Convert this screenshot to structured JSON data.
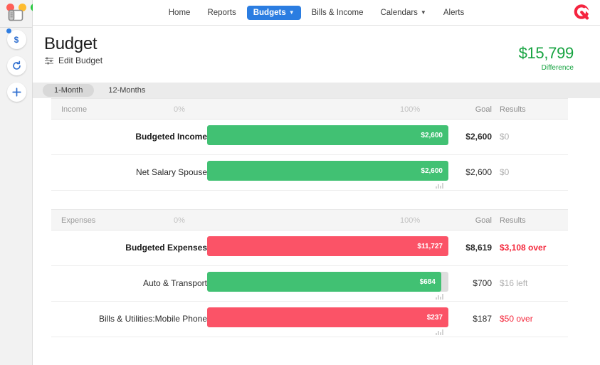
{
  "window": {
    "traffic_lights": [
      "close",
      "minimize",
      "maximize"
    ],
    "sidebar_toggle_icon": "sidebar-toggle-icon"
  },
  "rail": {
    "items": [
      {
        "icon": "dollar-circle-icon",
        "glyph": "$",
        "has_badge": true
      },
      {
        "icon": "refresh-circle-icon",
        "glyph": "↻",
        "has_badge": false
      },
      {
        "icon": "plus-circle-icon",
        "glyph": "+",
        "has_badge": false
      }
    ]
  },
  "nav": {
    "items": [
      {
        "label": "Home",
        "active": false,
        "has_caret": false
      },
      {
        "label": "Reports",
        "active": false,
        "has_caret": false
      },
      {
        "label": "Budgets",
        "active": true,
        "has_caret": true
      },
      {
        "label": "Bills & Income",
        "active": false,
        "has_caret": false
      },
      {
        "label": "Calendars",
        "active": false,
        "has_caret": true
      },
      {
        "label": "Alerts",
        "active": false,
        "has_caret": false
      }
    ],
    "logo_icon": "quicken-q-logo"
  },
  "header": {
    "title": "Budget",
    "edit_budget_label": "Edit Budget",
    "edit_budget_icon": "sliders-icon",
    "difference_amount": "$15,799",
    "difference_label": "Difference"
  },
  "tabs": [
    {
      "label": "1-Month",
      "active": true
    },
    {
      "label": "12-Months",
      "active": false
    }
  ],
  "colors": {
    "green": "#41c173",
    "red": "#fb5367",
    "accent_blue": "#2b7de1",
    "difference_green": "#16a340",
    "over_red": "#f4283c",
    "track_gray": "#dedede"
  },
  "columns": {
    "zero": "0%",
    "full": "100%",
    "goal": "Goal",
    "results": "Results"
  },
  "sections": [
    {
      "name": "Income",
      "rows": [
        {
          "label": "Budgeted Income",
          "bold": true,
          "bar_value": "$2,600",
          "bar_color": "green",
          "bar_percent": 100,
          "goal": "$2,600",
          "goal_bold": true,
          "results": "$0",
          "results_state": "muted",
          "sparkline": false
        },
        {
          "label": "Net Salary Spouse",
          "bold": false,
          "bar_value": "$2,600",
          "bar_color": "green",
          "bar_percent": 100,
          "goal": "$2,600",
          "goal_bold": false,
          "results": "$0",
          "results_state": "muted",
          "sparkline": true
        }
      ]
    },
    {
      "name": "Expenses",
      "rows": [
        {
          "label": "Budgeted Expenses",
          "bold": true,
          "bar_value": "$11,727",
          "bar_color": "red",
          "bar_percent": 100,
          "goal": "$8,619",
          "goal_bold": true,
          "results": "$3,108 over",
          "results_state": "over",
          "sparkline": false
        },
        {
          "label": "Auto & Transport",
          "bold": false,
          "bar_value": "$684",
          "bar_color": "green",
          "bar_percent": 97,
          "goal": "$700",
          "goal_bold": false,
          "results": "$16 left",
          "results_state": "muted",
          "sparkline": true
        },
        {
          "label": "Bills & Utilities:Mobile Phone",
          "bold": false,
          "bar_value": "$237",
          "bar_color": "red",
          "bar_percent": 100,
          "goal": "$187",
          "goal_bold": false,
          "results": "$50 over",
          "results_state": "over",
          "sparkline": true
        }
      ]
    }
  ]
}
